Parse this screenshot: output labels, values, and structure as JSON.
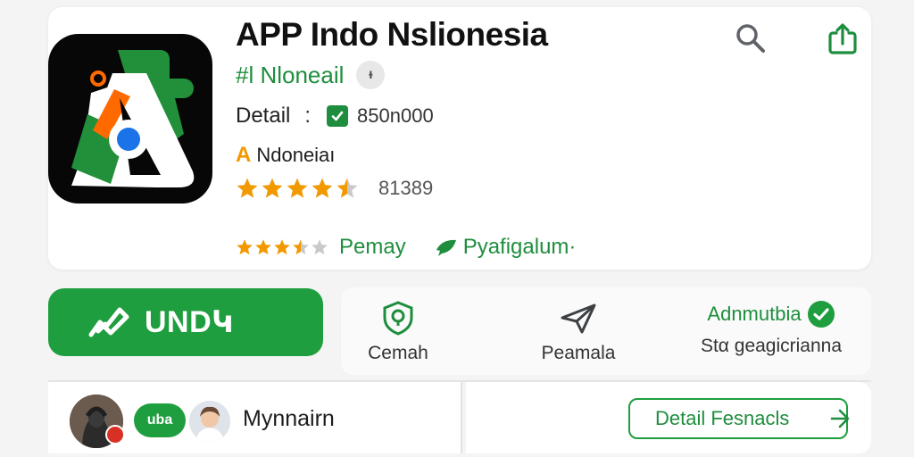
{
  "app": {
    "title": "APP Indo Nslionesia",
    "developer": "#l Nloneail",
    "info_glyph": "ᵻ",
    "detail_label": "Detail",
    "detail_sep": ":",
    "downloads": "850n000",
    "brand_letter": "A",
    "brand_name": "Ndoneiaı",
    "rating_stars": 4.5,
    "rating_count": "81389",
    "meta_stars": 3.5,
    "meta_label": "Pemay",
    "category_label": "Pyafigalum·"
  },
  "header_actions": {
    "search_icon": "search-icon",
    "share_icon": "share-icon"
  },
  "install": {
    "label": "UNDԿ",
    "icon": "install-icon"
  },
  "actions": [
    {
      "label": "Cemah",
      "icon": "shield-icon"
    },
    {
      "label": "Peamala",
      "icon": "send-icon"
    },
    {
      "title": "Adnmutbia",
      "label": "Stα geagicrianna",
      "icon": "verified-check-icon"
    }
  ],
  "reviewer": {
    "badge": "uba",
    "name": "Mynnairn"
  },
  "detail_button": {
    "label": "Detail Fesnacls"
  },
  "colors": {
    "primary_green": "#1e9e3e",
    "text_green": "#1e8e3e",
    "star_orange": "#f29900",
    "badge_red": "#d93025"
  }
}
